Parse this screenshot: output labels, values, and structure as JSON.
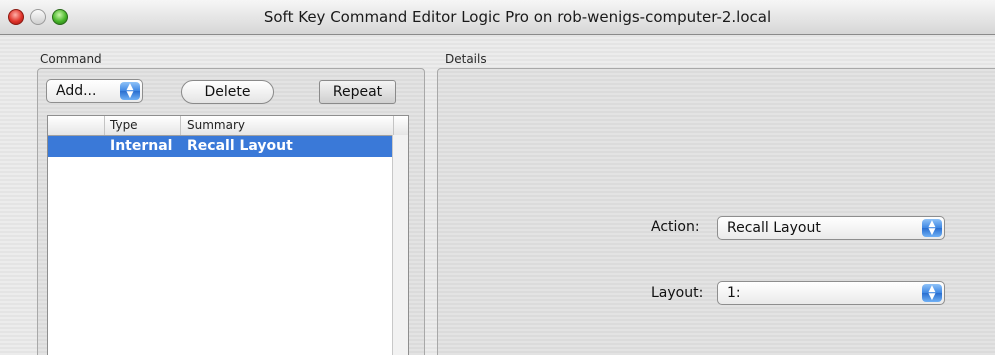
{
  "window": {
    "title": "Soft Key Command Editor Logic Pro on  rob-wenigs-computer-2.local"
  },
  "command_group": {
    "label": "Command",
    "add_popup": "Add...",
    "delete_button": "Delete",
    "repeat_button": "Repeat",
    "table": {
      "columns": [
        "",
        "Type",
        "Summary"
      ],
      "rows": [
        {
          "type": "Internal",
          "summary": "Recall Layout",
          "selected": true
        }
      ]
    }
  },
  "details_group": {
    "label": "Details",
    "action_label": "Action:",
    "action_value": "Recall Layout",
    "layout_label": "Layout:",
    "layout_value": "1:"
  },
  "icons": {
    "popup_arrows": "up-down-arrows-icon",
    "close": "close-icon",
    "minimize": "minimize-icon",
    "zoom": "zoom-icon"
  },
  "colors": {
    "selection": "#3a79d8",
    "popup_arrow": "#3d86e3"
  }
}
